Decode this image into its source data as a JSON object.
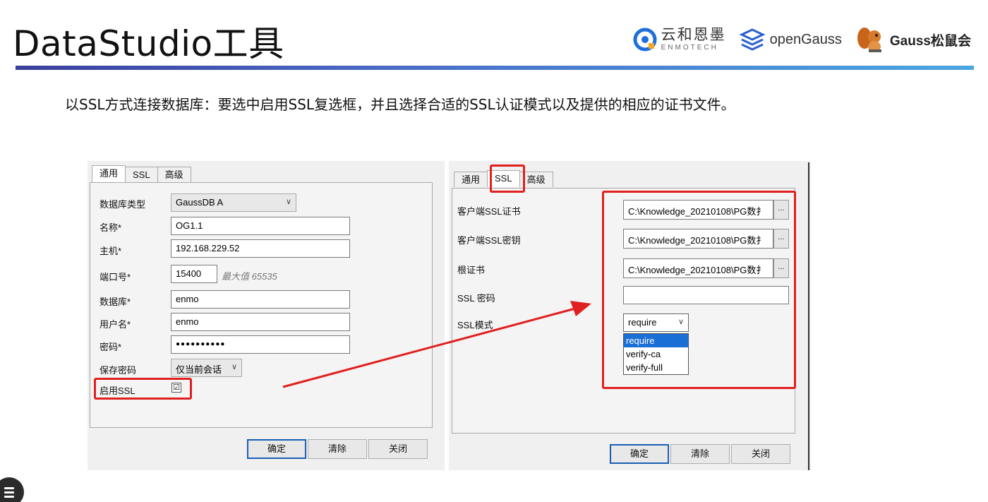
{
  "slide": {
    "title": "DataStudio工具",
    "description": "以SSL方式连接数据库：要选中启用SSL复选框，并且选择合适的SSL认证模式以及提供的相应的证书文件。"
  },
  "logos": {
    "enmo_cn": "云和恩墨",
    "enmo_en": "ENMOTECH",
    "opengauss": "openGauss",
    "gauss_club": "Gauss松鼠会"
  },
  "left_dialog": {
    "tabs": [
      "通用",
      "SSL",
      "高级"
    ],
    "fields": {
      "db_type_label": "数据库类型",
      "db_type_value": "GaussDB A",
      "name_label": "名称*",
      "name_value": "OG1.1",
      "host_label": "主机*",
      "host_value": "192.168.229.52",
      "port_label": "端口号*",
      "port_value": "15400",
      "port_hint": "最大值 65535",
      "database_label": "数据库*",
      "database_value": "enmo",
      "user_label": "用户名*",
      "user_value": "enmo",
      "password_label": "密码*",
      "password_value": "●●●●●●●●●●",
      "save_pwd_label": "保存密码",
      "save_pwd_value": "仅当前会话",
      "enable_ssl_label": "启用SSL",
      "enable_ssl_check": "☑"
    },
    "buttons": {
      "ok": "确定",
      "clear": "清除",
      "close": "关闭"
    }
  },
  "right_dialog": {
    "tabs": [
      "通用",
      "SSL",
      "高级"
    ],
    "fields": {
      "client_cert_label": "客户端SSL证书",
      "client_cert_value": "C:\\Knowledge_20210108\\PG数扌",
      "client_key_label": "客户端SSL密钥",
      "client_key_value": "C:\\Knowledge_20210108\\PG数扌",
      "root_cert_label": "根证书",
      "root_cert_value": "C:\\Knowledge_20210108\\PG数扌",
      "ssl_pwd_label": "SSL 密码",
      "ssl_pwd_value": "",
      "ssl_mode_label": "SSL模式",
      "ssl_mode_value": "require",
      "browse": "..."
    },
    "ssl_mode_options": [
      "require",
      "verify-ca",
      "verify-full"
    ],
    "buttons": {
      "ok": "确定",
      "clear": "清除",
      "close": "关闭"
    }
  },
  "colors": {
    "highlight": "#e02020",
    "accent": "#1a6fd6"
  }
}
